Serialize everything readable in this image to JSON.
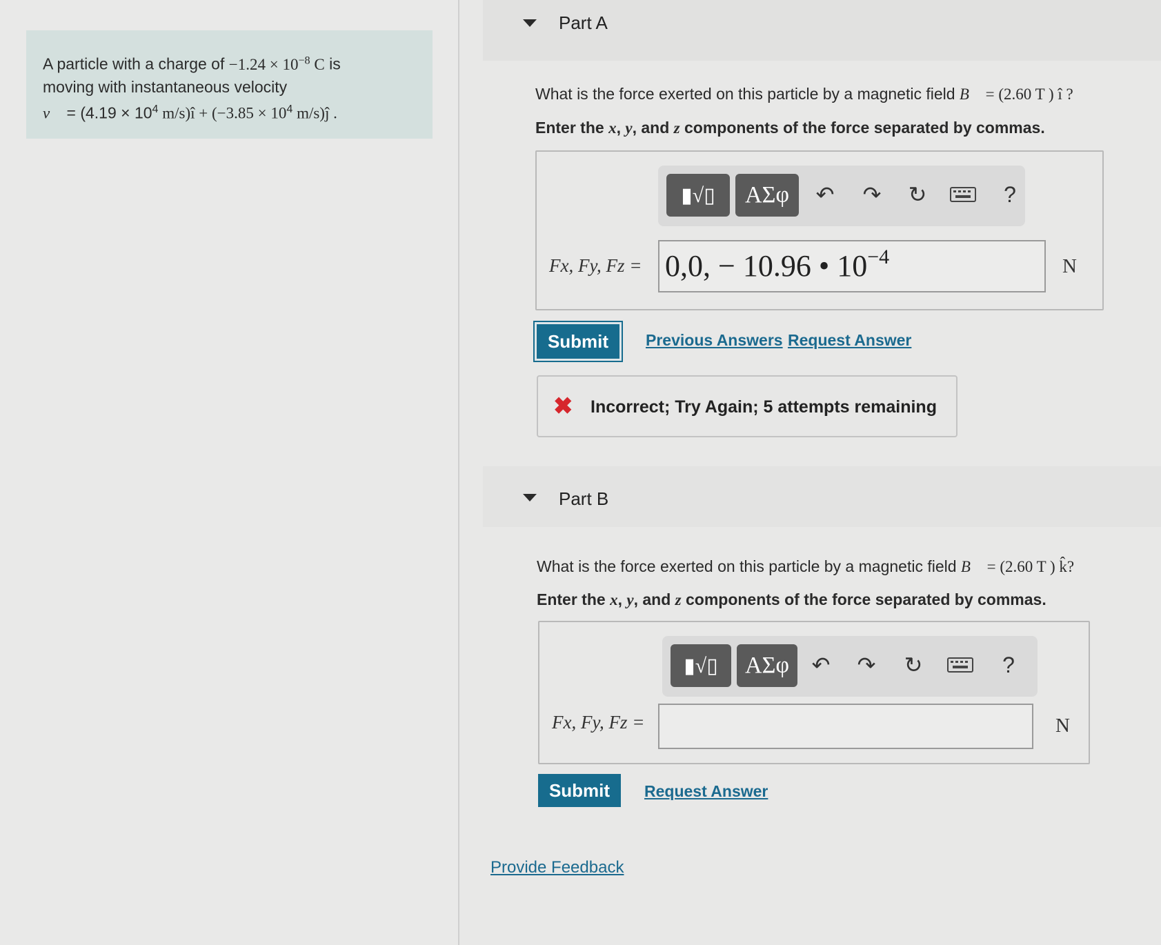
{
  "problem": {
    "line1_prefix": "A particle with a charge of ",
    "charge": "−1.24 × 10",
    "charge_exp": "−8",
    "charge_unit": " C",
    "line1_suffix": " is",
    "line2": "moving with instantaneous velocity",
    "velocity_symbol": "v⃗",
    "velocity_x": " = (4.19 × 10",
    "velocity_x_exp": "4",
    "velocity_x_unit": " m/s)î + (−3.85 × 10",
    "velocity_y_exp": "4",
    "velocity_y_unit": " m/s)ĵ ."
  },
  "partA": {
    "title": "Part A",
    "question_prefix": "What is the force exerted on this particle by a magnetic field ",
    "field_symbol": "B⃗",
    "field_value": " = (2.60  T ) î ?",
    "instruction_pre": "Enter the ",
    "var_x": "x",
    "sep1": ", ",
    "var_y": "y",
    "sep2": ", and ",
    "var_z": "z",
    "instruction_post": " components of the force separated by commas.",
    "equation_label": "Fx, Fy, Fz =",
    "answer_value": "0,0, − 10.96 • 10",
    "answer_exp": "−4",
    "unit": "N",
    "submit_label": "Submit",
    "previous_answers_label": "Previous Answers",
    "request_answer_label": "Request Answer",
    "feedback": "Incorrect; Try Again; 5 attempts remaining"
  },
  "partB": {
    "title": "Part B",
    "question_prefix": "What is the force exerted on this particle by a magnetic field ",
    "field_symbol": "B⃗",
    "field_value": " = (2.60  T ) k̂?",
    "instruction_pre": "Enter the ",
    "var_x": "x",
    "sep1": ", ",
    "var_y": "y",
    "sep2": ", and ",
    "var_z": "z",
    "instruction_post": " components of the force separated by commas.",
    "equation_label": "Fx, Fy, Fz =",
    "answer_value": "",
    "unit": "N",
    "submit_label": "Submit",
    "request_answer_label": "Request Answer"
  },
  "toolbar": {
    "templates_icon": "templates-sqrt-icon",
    "greek_label": "ΑΣφ",
    "undo_icon": "undo-icon",
    "redo_icon": "redo-icon",
    "reset_icon": "reset-icon",
    "keyboard_icon": "keyboard-icon",
    "help_label": "?"
  },
  "footer": {
    "provide_feedback_label": "Provide Feedback"
  }
}
